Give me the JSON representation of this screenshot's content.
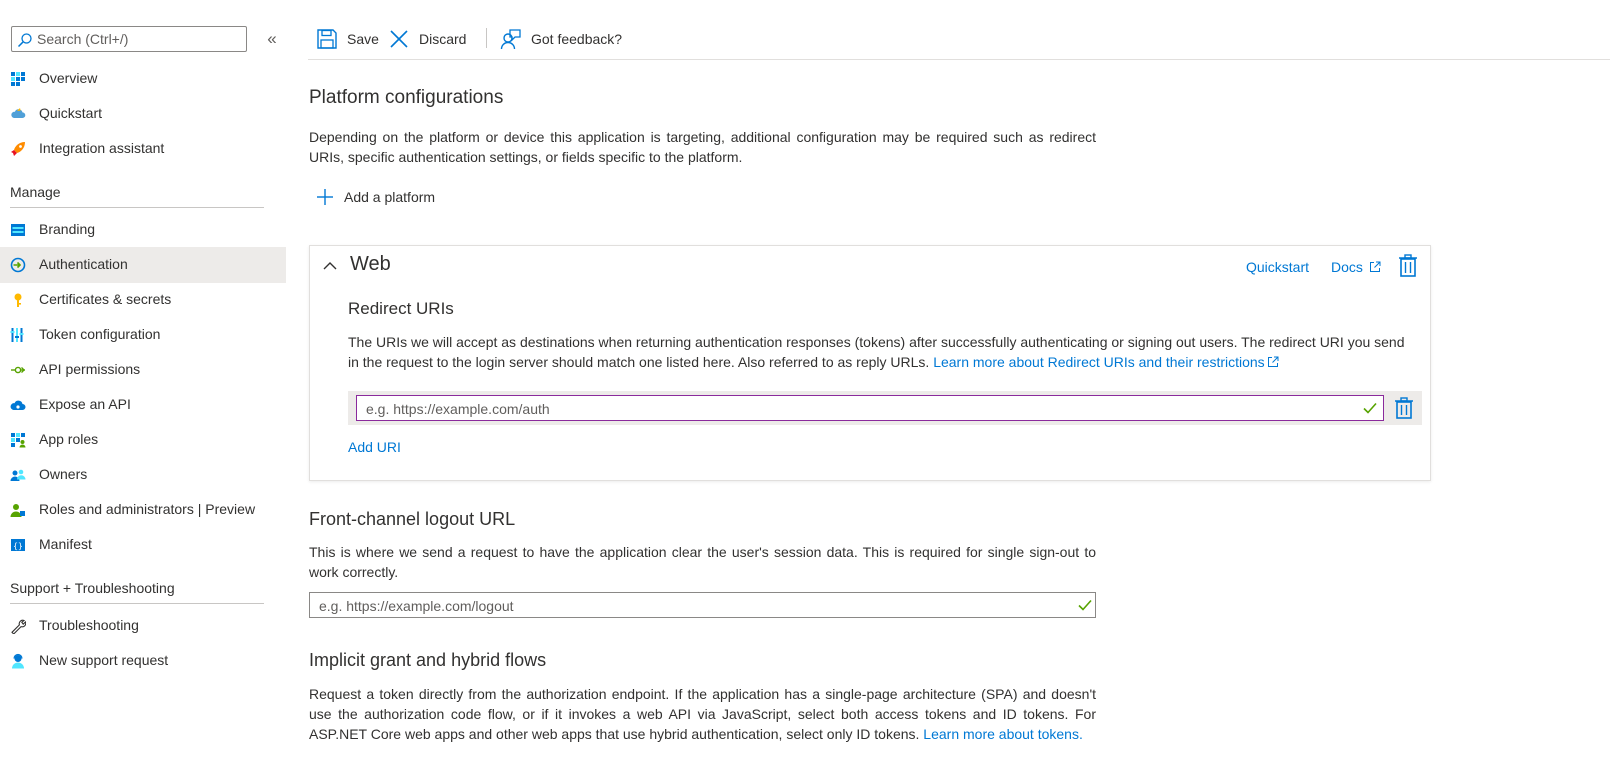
{
  "sidebar": {
    "search_placeholder": "Search (Ctrl+/)",
    "collapse_glyph": "«",
    "top_items": [
      {
        "label": "Overview",
        "icon": "overview-grid-icon"
      },
      {
        "label": "Quickstart",
        "icon": "quickstart-cloud-icon"
      },
      {
        "label": "Integration assistant",
        "icon": "rocket-icon"
      }
    ],
    "manage_heading": "Manage",
    "manage_items": [
      {
        "label": "Branding",
        "icon": "branding-icon"
      },
      {
        "label": "Authentication",
        "icon": "authentication-icon",
        "active": true
      },
      {
        "label": "Certificates & secrets",
        "icon": "key-icon"
      },
      {
        "label": "Token configuration",
        "icon": "token-bars-icon"
      },
      {
        "label": "API permissions",
        "icon": "api-permissions-icon"
      },
      {
        "label": "Expose an API",
        "icon": "expose-api-cloud-icon"
      },
      {
        "label": "App roles",
        "icon": "app-roles-grid-icon"
      },
      {
        "label": "Owners",
        "icon": "owners-people-icon"
      },
      {
        "label": "Roles and administrators | Preview",
        "icon": "roles-admin-icon"
      },
      {
        "label": "Manifest",
        "icon": "manifest-icon"
      }
    ],
    "support_heading": "Support + Troubleshooting",
    "support_items": [
      {
        "label": "Troubleshooting",
        "icon": "wrench-icon"
      },
      {
        "label": "New support request",
        "icon": "support-person-icon"
      }
    ]
  },
  "toolbar": {
    "save_label": "Save",
    "discard_label": "Discard",
    "feedback_label": "Got feedback?"
  },
  "platform": {
    "title": "Platform configurations",
    "description": "Depending on the platform or device this application is targeting, additional configuration may be required such as redirect URIs, specific authentication settings, or fields specific to the platform.",
    "add_platform_label": "Add a platform"
  },
  "web": {
    "title": "Web",
    "quickstart_link": "Quickstart",
    "docs_link": "Docs",
    "redirect_heading": "Redirect URIs",
    "redirect_description": "The URIs we will accept as destinations when returning authentication responses (tokens) after successfully authenticating or signing out users. The redirect URI you send in the request to the login server should match one listed here. Also referred to as reply URLs.",
    "redirect_learn_more": "Learn more about Redirect URIs and their restrictions",
    "uri_placeholder": "e.g. https://example.com/auth",
    "uri_value": "",
    "add_uri_label": "Add URI"
  },
  "logout": {
    "title": "Front-channel logout URL",
    "description": "This is where we send a request to have the application clear the user's session data. This is required for single sign-out to work correctly.",
    "placeholder": "e.g. https://example.com/logout",
    "value": ""
  },
  "implicit": {
    "title": "Implicit grant and hybrid flows",
    "description": "Request a token directly from the authorization endpoint. If the application has a single-page architecture (SPA) and doesn't use the authorization code flow, or if it invokes a web API via JavaScript, select both access tokens and ID tokens. For ASP.NET Core web apps and other web apps that use hybrid authentication, select only ID tokens.",
    "learn_more": "Learn more about tokens."
  },
  "colors": {
    "accent": "#0078d4",
    "valid_check": "#57a300",
    "focused_border": "#8a2a9c",
    "active_nav_bg": "#edebe9"
  }
}
